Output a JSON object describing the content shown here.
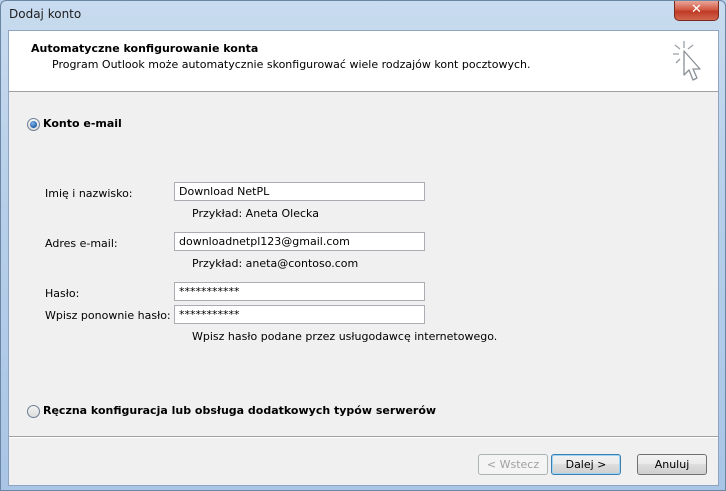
{
  "window": {
    "title": "Dodaj konto",
    "close_label": "✕"
  },
  "header": {
    "title": "Automatyczne konfigurowanie konta",
    "subtitle": "Program Outlook może automatycznie skonfigurować wiele rodzajów kont pocztowych."
  },
  "option_email": {
    "label": "Konto e-mail",
    "checked": true
  },
  "form": {
    "name_label": "Imię i nazwisko:",
    "name_value": "Download NetPL",
    "name_hint": "Przykład: Aneta Olecka",
    "email_label": "Adres e-mail:",
    "email_value": "downloadnetpl123@gmail.com",
    "email_hint": "Przykład: aneta@contoso.com",
    "password_label": "Hasło:",
    "password_value": "***********",
    "password_repeat_label": "Wpisz ponownie hasło:",
    "password_repeat_value": "***********",
    "password_hint": "Wpisz hasło podane przez usługodawcę internetowego."
  },
  "option_manual": {
    "label": "Ręczna konfiguracja lub obsługa dodatkowych typów serwerów",
    "checked": false
  },
  "buttons": {
    "back": "< Wstecz",
    "next": "Dalej >",
    "cancel": "Anuluj"
  }
}
